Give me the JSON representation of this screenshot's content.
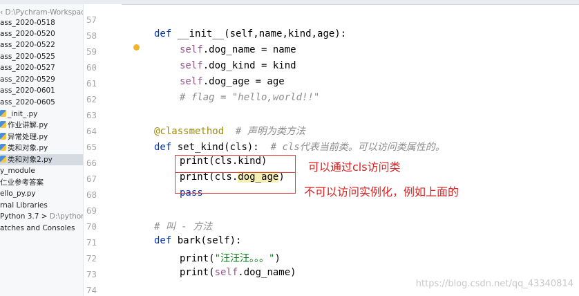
{
  "sidebar": {
    "root": "D:\\Pychram-Workspace",
    "items": [
      {
        "label": "ass_2020-0518"
      },
      {
        "label": "ass_2020-0520"
      },
      {
        "label": "ass_2020-0522"
      },
      {
        "label": "ass_2020-0525"
      },
      {
        "label": "ass_2020-0527"
      },
      {
        "label": "ass_2020-0529"
      },
      {
        "label": "ass_2020-0601"
      },
      {
        "label": "ass_2020-0605"
      },
      {
        "label": "_init_.py"
      },
      {
        "label": "作业讲解.py"
      },
      {
        "label": "异常处理.py"
      },
      {
        "label": "类和对象.py"
      },
      {
        "label": "类和对象2.py"
      },
      {
        "label": "y_module"
      },
      {
        "label": "仁业参考答案"
      },
      {
        "label": "ello_py.py"
      },
      {
        "label": "rnal Libraries"
      },
      {
        "label": "Python 3.7 >",
        "path": "D:\\python"
      },
      {
        "label": "atches and Consoles"
      }
    ]
  },
  "line_numbers": [
    "57",
    "58",
    "59",
    "60",
    "61",
    "62",
    "63",
    "64",
    "65",
    "66",
    "67",
    "68",
    "69",
    "70",
    "71",
    "72",
    "73",
    "74"
  ],
  "code": {
    "l58_kw": "def",
    "l58_rest": " __init__(self,name,kind,age):",
    "l59_self": "self",
    "l59_rest": ".dog_name = name",
    "l60_self": "self",
    "l60_rest": ".dog_kind = kind",
    "l61_self": "self",
    "l61_rest": ".dog_age = age",
    "l62_cmt": "# flag = \"hello,world!!\"",
    "l64_deco": "@classmethod",
    "l64_cmt": "  # 声明为类方法",
    "l65_kw": "def",
    "l65_rest": " set_kind(cls):",
    "l65_cmt": "  # cls代表当前类。可以访问类属性的。",
    "l66": "print(cls.kind)",
    "l67_a": "print(cls.",
    "l67_hl": "dog_age",
    "l67_b": ")",
    "l68_kw": "pass",
    "l70_cmt": "# 叫 - 方法",
    "l71_kw": "def",
    "l71_rest": " bark(self):",
    "l72_a": "print(",
    "l72_str": "\"汪汪汪。。。\"",
    "l72_b": ")",
    "l73_a": "print(",
    "l73_self": "self",
    "l73_b": ".dog_name)"
  },
  "annotations": {
    "note1": "可以通过cls访问类",
    "note2": "不可以访问实例化，例如上面的"
  },
  "watermark": "https://blog.csdn.net/qq_43340814",
  "colors": {
    "keyword": "#0033b3",
    "self": "#94558d",
    "decorator": "#9e880d",
    "comment": "#8c8c8c",
    "string": "#067d17",
    "annotation_red": "#d82020"
  }
}
